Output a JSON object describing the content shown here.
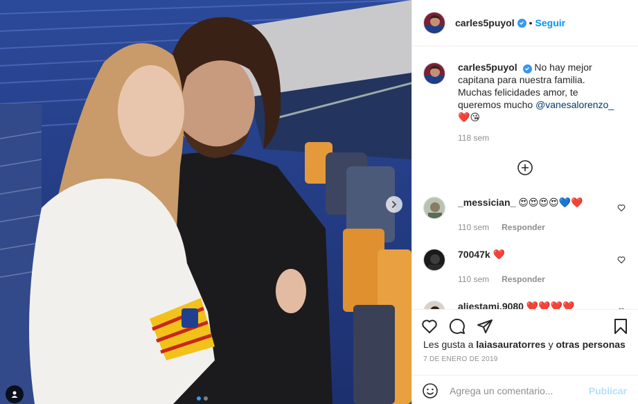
{
  "post": {
    "username": "carles5puyol",
    "follow_label": "Seguir",
    "separator": "•",
    "caption_text": "No hay mejor capitana para nuestra familia. Muchas felicidades amor, te queremos mucho ",
    "caption_mention": "@vanesalorenzo_",
    "caption_emoji": "❤️😘",
    "caption_age": "118 sem",
    "carousel_dots": 2,
    "carousel_active_index": 0,
    "icons": [
      "verified-badge",
      "chevron-right-icon",
      "person-tag-icon",
      "plus-circle-icon",
      "heart-icon",
      "comment-icon",
      "share-icon",
      "bookmark-icon",
      "emoji-icon"
    ]
  },
  "comments": [
    {
      "username": "_messician_",
      "text": "😍😍😍😍💙❤️",
      "age": "110 sem",
      "reply_label": "Responder"
    },
    {
      "username": "70047k",
      "text": "❤️",
      "age": "110 sem",
      "reply_label": "Responder"
    },
    {
      "username": "aliestami.9080",
      "text": "❤️❤️❤️❤️",
      "age": "",
      "reply_label": ""
    }
  ],
  "footer": {
    "likes_prefix": "Les gusta a ",
    "likes_user": "laiasauratorres",
    "likes_and": " y ",
    "likes_others": "otras personas",
    "date": "7 DE ENERO DE 2019",
    "comment_placeholder": "Agrega un comentario...",
    "publish_label": "Publicar"
  },
  "colors": {
    "accent_blue": "#0095f6",
    "mention": "#00376b",
    "muted": "#8e8e8e",
    "publish_disabled": "#b2dffc"
  }
}
